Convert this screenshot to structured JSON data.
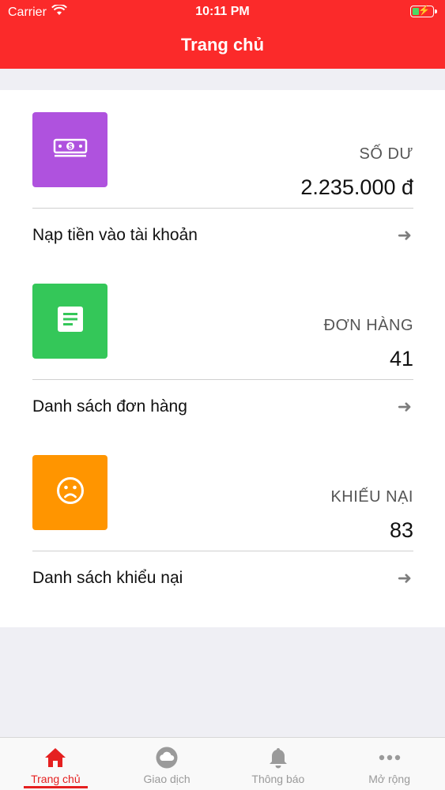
{
  "status_bar": {
    "carrier": "Carrier",
    "time": "10:11 PM"
  },
  "header": {
    "title": "Trang chủ"
  },
  "sections": [
    {
      "icon": "money-icon",
      "label": "SỐ DƯ",
      "value": "2.235.000 đ",
      "link": "Nạp tiền vào tài khoản",
      "color": "#af52de"
    },
    {
      "icon": "document-icon",
      "label": "ĐƠN HÀNG",
      "value": "41",
      "link": "Danh sách đơn hàng",
      "color": "#34c759"
    },
    {
      "icon": "sad-face-icon",
      "label": "KHIẾU NẠI",
      "value": "83",
      "link": "Danh sách khiểu nại",
      "color": "#ff9500"
    }
  ],
  "tabbar": {
    "active": "Trang chủ",
    "tabs": [
      {
        "label": "Trang chủ",
        "icon": "home-icon"
      },
      {
        "label": "Giao dịch",
        "icon": "cloud-icon"
      },
      {
        "label": "Thông báo",
        "icon": "bell-icon"
      },
      {
        "label": "Mở rộng",
        "icon": "more-icon"
      }
    ]
  },
  "colors": {
    "primary": "#fb2a2a",
    "active_tab": "#e52020"
  }
}
